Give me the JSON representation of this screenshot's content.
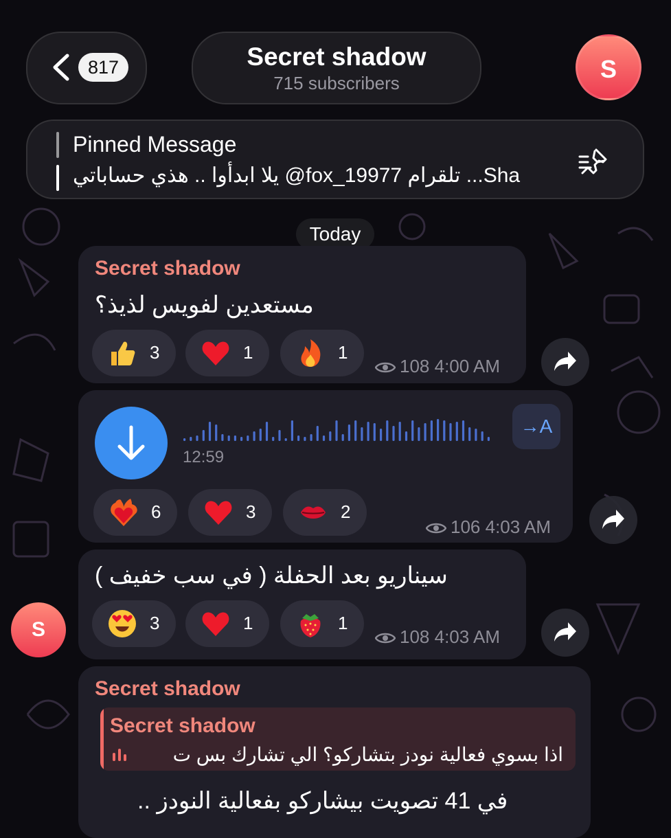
{
  "header": {
    "back_count": "817",
    "channel_title": "Secret shadow",
    "subscribers": "715 subscribers",
    "avatar_letter": "S"
  },
  "pinned": {
    "title": "Pinned Message",
    "text": "يلا ابدأوا .. هذي حساباتي @fox_19977 تلقرام ...Sha"
  },
  "date_separator": "Today",
  "messages": [
    {
      "sender": "Secret shadow",
      "text": "مستعدين لفويس لذيذ؟",
      "reactions": [
        {
          "emoji": "thumbs-up",
          "count": "3"
        },
        {
          "emoji": "red-heart",
          "count": "1"
        },
        {
          "emoji": "fire",
          "count": "1"
        }
      ],
      "views": "108",
      "time": "4:00 AM"
    },
    {
      "type": "voice",
      "duration": "12:59",
      "translate_label": "→A",
      "reactions": [
        {
          "emoji": "heart-on-fire",
          "count": "6"
        },
        {
          "emoji": "red-heart",
          "count": "3"
        },
        {
          "emoji": "kiss-mark",
          "count": "2"
        }
      ],
      "views": "106",
      "time": "4:03 AM"
    },
    {
      "text": "سيناريو بعد الحفلة ( في سب خفيف )",
      "reactions": [
        {
          "emoji": "heart-eyes",
          "count": "3"
        },
        {
          "emoji": "red-heart",
          "count": "1"
        },
        {
          "emoji": "strawberry",
          "count": "1"
        }
      ],
      "views": "108",
      "time": "4:03 AM",
      "avatar_letter": "S"
    },
    {
      "sender": "Secret shadow",
      "reply": {
        "sender": "Secret shadow",
        "text": "اذا بسوي فعالية نودز بتشاركو؟ الي تشارك بس ت"
      },
      "text": "في 41 تصويت بيشاركو بفعالية النودز .."
    }
  ],
  "colors": {
    "bubble": "#1f1e28",
    "sender": "#f0877c",
    "voice_button": "#3a8ef0",
    "waveform_played": "#4a6fcf"
  }
}
